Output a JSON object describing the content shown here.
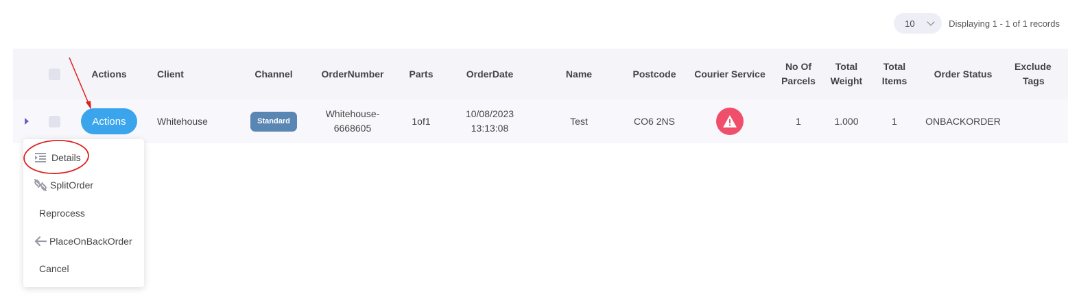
{
  "pager": {
    "page_size": "10",
    "status_text": "Displaying 1 - 1 of 1 records"
  },
  "table": {
    "headers": {
      "actions": "Actions",
      "client": "Client",
      "channel": "Channel",
      "order_number": "OrderNumber",
      "parts": "Parts",
      "order_date": "OrderDate",
      "name": "Name",
      "postcode": "Postcode",
      "courier_service": "Courier Service",
      "no_of_parcels_1": "No Of",
      "no_of_parcels_2": "Parcels",
      "total_weight_1": "Total",
      "total_weight_2": "Weight",
      "total_items_1": "Total",
      "total_items_2": "Items",
      "order_status": "Order Status",
      "exclude_tags_1": "Exclude",
      "exclude_tags_2": "Tags"
    },
    "row": {
      "actions_label": "Actions",
      "client": "Whitehouse",
      "channel": "Standard",
      "order_number_1": "Whitehouse-",
      "order_number_2": "6668605",
      "parts": "1of1",
      "order_date_1": "10/08/2023",
      "order_date_2": "13:13:08",
      "name": "Test",
      "postcode": "CO6 2NS",
      "courier_service_icon": "warning-icon",
      "no_of_parcels": "1",
      "total_weight": "1.000",
      "total_items": "1",
      "order_status": "ONBACKORDER"
    }
  },
  "menu": {
    "items": [
      {
        "label": "Details",
        "icon": "details-list-icon"
      },
      {
        "label": "SplitOrder",
        "icon": "unlink-icon"
      },
      {
        "label": "Reprocess",
        "icon": ""
      },
      {
        "label": "PlaceOnBackOrder",
        "icon": "arrow-left-icon"
      },
      {
        "label": "Cancel",
        "icon": ""
      }
    ]
  },
  "colors": {
    "actions_button": "#3aa4ec",
    "channel_badge": "#5a86b4",
    "warning_circle": "#ef4f6a",
    "annotation_red": "#e02020"
  }
}
